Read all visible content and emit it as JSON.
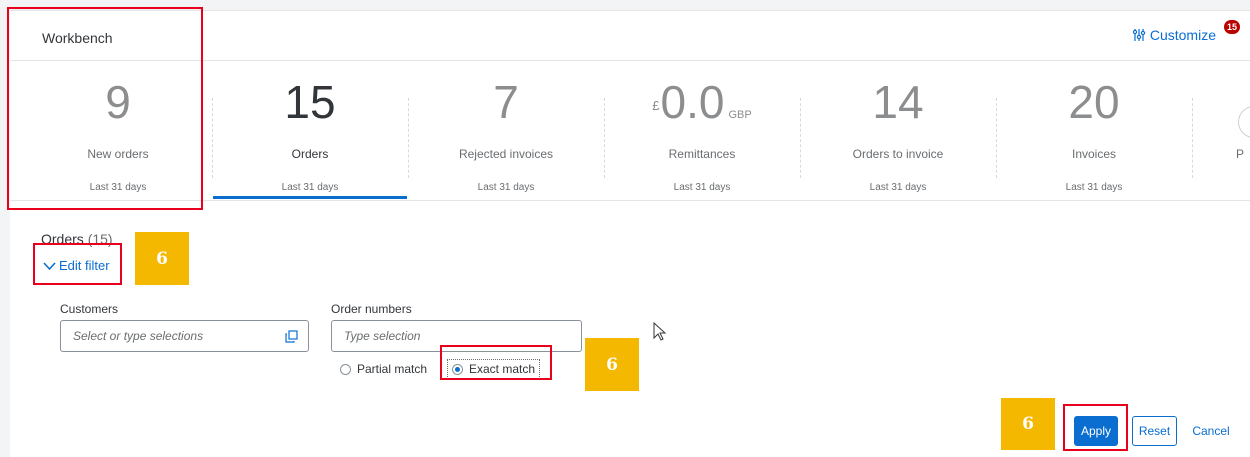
{
  "workbench": {
    "title": "Workbench",
    "customize_label": "Customize",
    "customize_badge": "15"
  },
  "tiles": [
    {
      "value": "9",
      "label": "New orders",
      "period": "Last 31 days"
    },
    {
      "value": "15",
      "label": "Orders",
      "period": "Last 31 days",
      "active": true
    },
    {
      "value": "7",
      "label": "Rejected invoices",
      "period": "Last 31 days"
    },
    {
      "currency_symbol": "£",
      "value": "0.0",
      "currency_code": "GBP",
      "label": "Remittances",
      "period": "Last 31 days"
    },
    {
      "value": "14",
      "label": "Orders to invoice",
      "period": "Last 31 days"
    },
    {
      "value": "20",
      "label": "Invoices",
      "period": "Last 31 days"
    },
    {
      "label": "P"
    }
  ],
  "orders": {
    "title": "Orders",
    "count": "(15)",
    "edit_filter_label": "Edit filter"
  },
  "filters": {
    "customers_label": "Customers",
    "customers_placeholder": "Select or type selections",
    "order_numbers_label": "Order numbers",
    "order_numbers_placeholder": "Type selection",
    "match_options": [
      {
        "label": "Partial match",
        "selected": false
      },
      {
        "label": "Exact match",
        "selected": true
      }
    ]
  },
  "actions": {
    "apply_label": "Apply",
    "reset_label": "Reset",
    "cancel_label": "Cancel"
  },
  "annotations": {
    "step_edit_filter": "6",
    "step_exact_match": "6",
    "step_apply": "6",
    "highlight_color": "#e8001c",
    "step_color": "#f5b800"
  },
  "colors": {
    "accent": "#0a6ed1",
    "badge": "#bb0000"
  }
}
